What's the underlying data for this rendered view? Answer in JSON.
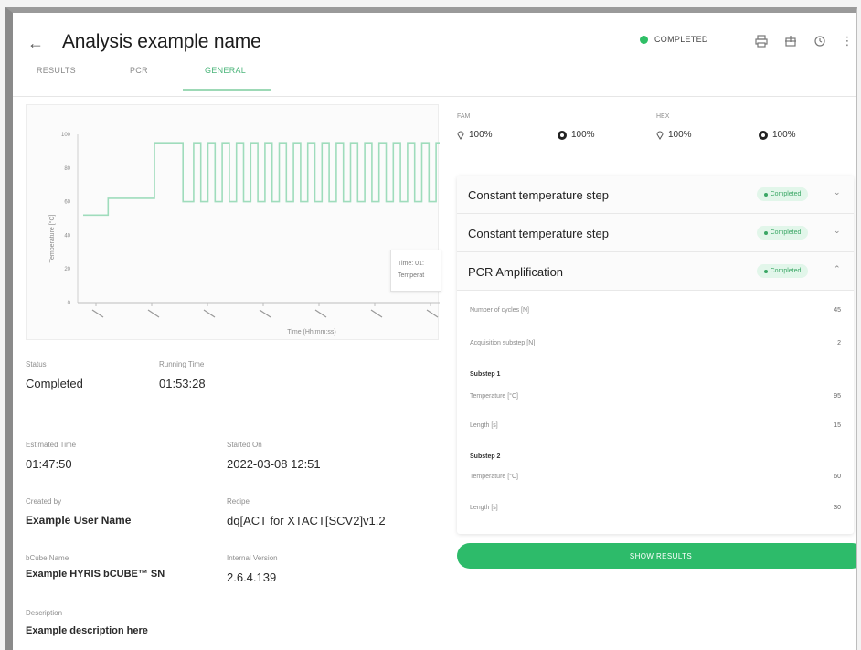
{
  "header": {
    "title": "Analysis example name",
    "status": "COMPLETED",
    "status_color": "#2fbf66",
    "icons": [
      "back-arrow-icon",
      "print-icon",
      "export-icon",
      "history-icon",
      "more-vertical-icon"
    ]
  },
  "tabs": [
    {
      "label": "RESULTS",
      "active": false
    },
    {
      "label": "PCR",
      "active": false
    },
    {
      "label": "GENERAL",
      "active": true
    }
  ],
  "chart_data": {
    "type": "line",
    "title": "",
    "xlabel": "Time (Hh:mm:ss)",
    "ylabel": "Temperature [°C]",
    "ylim": [
      0,
      100
    ],
    "yticks": [
      "0",
      "20",
      "40",
      "60",
      "80",
      "100"
    ],
    "xtick_count": 7,
    "color": "#9fdcbc",
    "series": [
      {
        "points": [
          [
            0,
            52
          ],
          [
            7,
            52
          ],
          [
            7,
            62
          ],
          [
            20,
            62
          ],
          [
            20,
            95
          ],
          [
            28,
            95
          ],
          [
            28,
            60
          ],
          [
            31,
            60
          ],
          [
            31,
            95
          ],
          [
            33,
            95
          ],
          [
            33,
            60
          ],
          [
            35,
            60
          ],
          [
            35,
            95
          ],
          [
            37,
            95
          ],
          [
            37,
            60
          ],
          [
            39,
            60
          ],
          [
            39,
            95
          ],
          [
            41,
            95
          ],
          [
            41,
            60
          ],
          [
            43,
            60
          ],
          [
            43,
            95
          ],
          [
            45,
            95
          ],
          [
            45,
            60
          ],
          [
            47,
            60
          ],
          [
            47,
            95
          ],
          [
            49,
            95
          ],
          [
            49,
            60
          ],
          [
            51,
            60
          ],
          [
            51,
            95
          ],
          [
            53,
            95
          ],
          [
            53,
            60
          ],
          [
            55,
            60
          ],
          [
            55,
            95
          ],
          [
            57,
            95
          ],
          [
            57,
            60
          ],
          [
            59,
            60
          ],
          [
            59,
            95
          ],
          [
            61,
            95
          ],
          [
            61,
            60
          ],
          [
            63,
            60
          ],
          [
            63,
            95
          ],
          [
            65,
            95
          ],
          [
            65,
            60
          ],
          [
            67,
            60
          ],
          [
            67,
            95
          ],
          [
            69,
            95
          ],
          [
            69,
            60
          ],
          [
            71,
            60
          ],
          [
            71,
            95
          ],
          [
            73,
            95
          ],
          [
            73,
            60
          ],
          [
            75,
            60
          ],
          [
            75,
            95
          ],
          [
            77,
            95
          ],
          [
            77,
            60
          ],
          [
            79,
            60
          ],
          [
            79,
            95
          ],
          [
            81,
            95
          ],
          [
            81,
            60
          ],
          [
            83,
            60
          ],
          [
            83,
            95
          ],
          [
            85,
            95
          ],
          [
            85,
            60
          ],
          [
            87,
            60
          ],
          [
            87,
            95
          ],
          [
            89,
            95
          ],
          [
            89,
            60
          ],
          [
            91,
            60
          ],
          [
            91,
            95
          ],
          [
            93,
            95
          ],
          [
            93,
            60
          ],
          [
            95,
            60
          ],
          [
            95,
            95
          ],
          [
            97,
            95
          ],
          [
            97,
            60
          ],
          [
            99,
            60
          ],
          [
            99,
            95
          ],
          [
            100,
            95
          ]
        ]
      }
    ],
    "tooltip": {
      "line1": "Time: 01:",
      "line2": "Temperat"
    }
  },
  "info": {
    "status_label": "Status",
    "status_value": "Completed",
    "running_label": "Running Time",
    "running_value": "01:53:28",
    "estimated_label": "Estimated Time",
    "estimated_value": "01:47:50",
    "started_label": "Started On",
    "started_value": "2022-03-08 12:51",
    "created_label": "Created by",
    "created_value": "Example User Name",
    "recipe_label": "Recipe",
    "recipe_value": "dq[ACT for XTACT[SCV2]v1.2",
    "bcube_label": "bCube Name",
    "bcube_value": "Example HYRIS bCUBE™ SN",
    "internal_label": "Internal Version",
    "internal_value": "2.6.4.139",
    "description_label": "Description",
    "description_value": "Example description here"
  },
  "channels": [
    {
      "name": "FAM",
      "pin_value": "100%",
      "gauge_value": "100%"
    },
    {
      "name": "HEX",
      "pin_value": "100%",
      "gauge_value": "100%"
    }
  ],
  "steps": [
    {
      "title": "Constant temperature step",
      "badge": "Completed",
      "expanded": false
    },
    {
      "title": "Constant temperature step",
      "badge": "Completed",
      "expanded": false
    },
    {
      "title": "PCR Amplification",
      "badge": "Completed",
      "expanded": true
    }
  ],
  "pcr_details": {
    "cycles_label": "Number of cycles [N]",
    "cycles_value": "45",
    "acq_label": "Acquisition substep [N]",
    "acq_value": "2",
    "sub1_title": "Substep 1",
    "sub1_temp_label": "Temperature [°C]",
    "sub1_temp_value": "95",
    "sub1_len_label": "Length [s]",
    "sub1_len_value": "15",
    "sub2_title": "Substep 2",
    "sub2_temp_label": "Temperature [°C]",
    "sub2_temp_value": "60",
    "sub2_len_label": "Length [s]",
    "sub2_len_value": "30"
  },
  "show_results_label": "SHOW RESULTS",
  "badge_color": "#3aa765",
  "button_color": "#2dbb6a"
}
